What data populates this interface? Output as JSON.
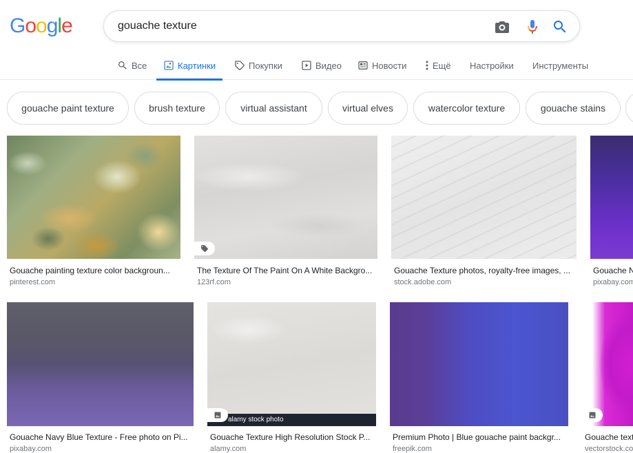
{
  "logo": {
    "letters": [
      "G",
      "o",
      "o",
      "g",
      "l",
      "e"
    ]
  },
  "colors": {
    "accent": "#1a73e8",
    "blue": "#4285f4",
    "red": "#ea4335",
    "yellow": "#fbbc05",
    "green": "#34a853"
  },
  "search": {
    "query": "gouache texture"
  },
  "tabs": [
    {
      "label": "Все",
      "icon": "search-icon"
    },
    {
      "label": "Картинки",
      "icon": "image-icon",
      "active": true
    },
    {
      "label": "Покупки",
      "icon": "tag-icon"
    },
    {
      "label": "Видео",
      "icon": "play-icon"
    },
    {
      "label": "Новости",
      "icon": "news-icon"
    },
    {
      "label": "Ещё",
      "icon": "more-vert-icon"
    },
    {
      "label": "Настройки"
    },
    {
      "label": "Инструменты"
    }
  ],
  "chips": [
    "gouache paint texture",
    "brush texture",
    "virtual assistant",
    "virtual elves",
    "watercolor texture",
    "gouache stains"
  ],
  "results": [
    {
      "caption": "Gouache painting texture color backgroun...",
      "source": "pinterest.com"
    },
    {
      "caption": "The Texture Of The Paint On A White Backgro...",
      "source": "123rf.com"
    },
    {
      "caption": "Gouache Texture photos, royalty-free images, ...",
      "source": "stock.adobe.com"
    },
    {
      "caption": "Gouache N",
      "source": "pixabay.com"
    },
    {
      "caption": "Gouache Navy Blue Texture - Free photo on Pi...",
      "source": "pixabay.com"
    },
    {
      "caption": "Gouache Texture High Resolution Stock P...",
      "source": "alamy.com",
      "watermark": "alamy stock photo"
    },
    {
      "caption": "Premium Photo | Blue gouache paint backgr...",
      "source": "freepik.com"
    },
    {
      "caption": "Gouache text",
      "source": "vectorstock.com"
    }
  ]
}
